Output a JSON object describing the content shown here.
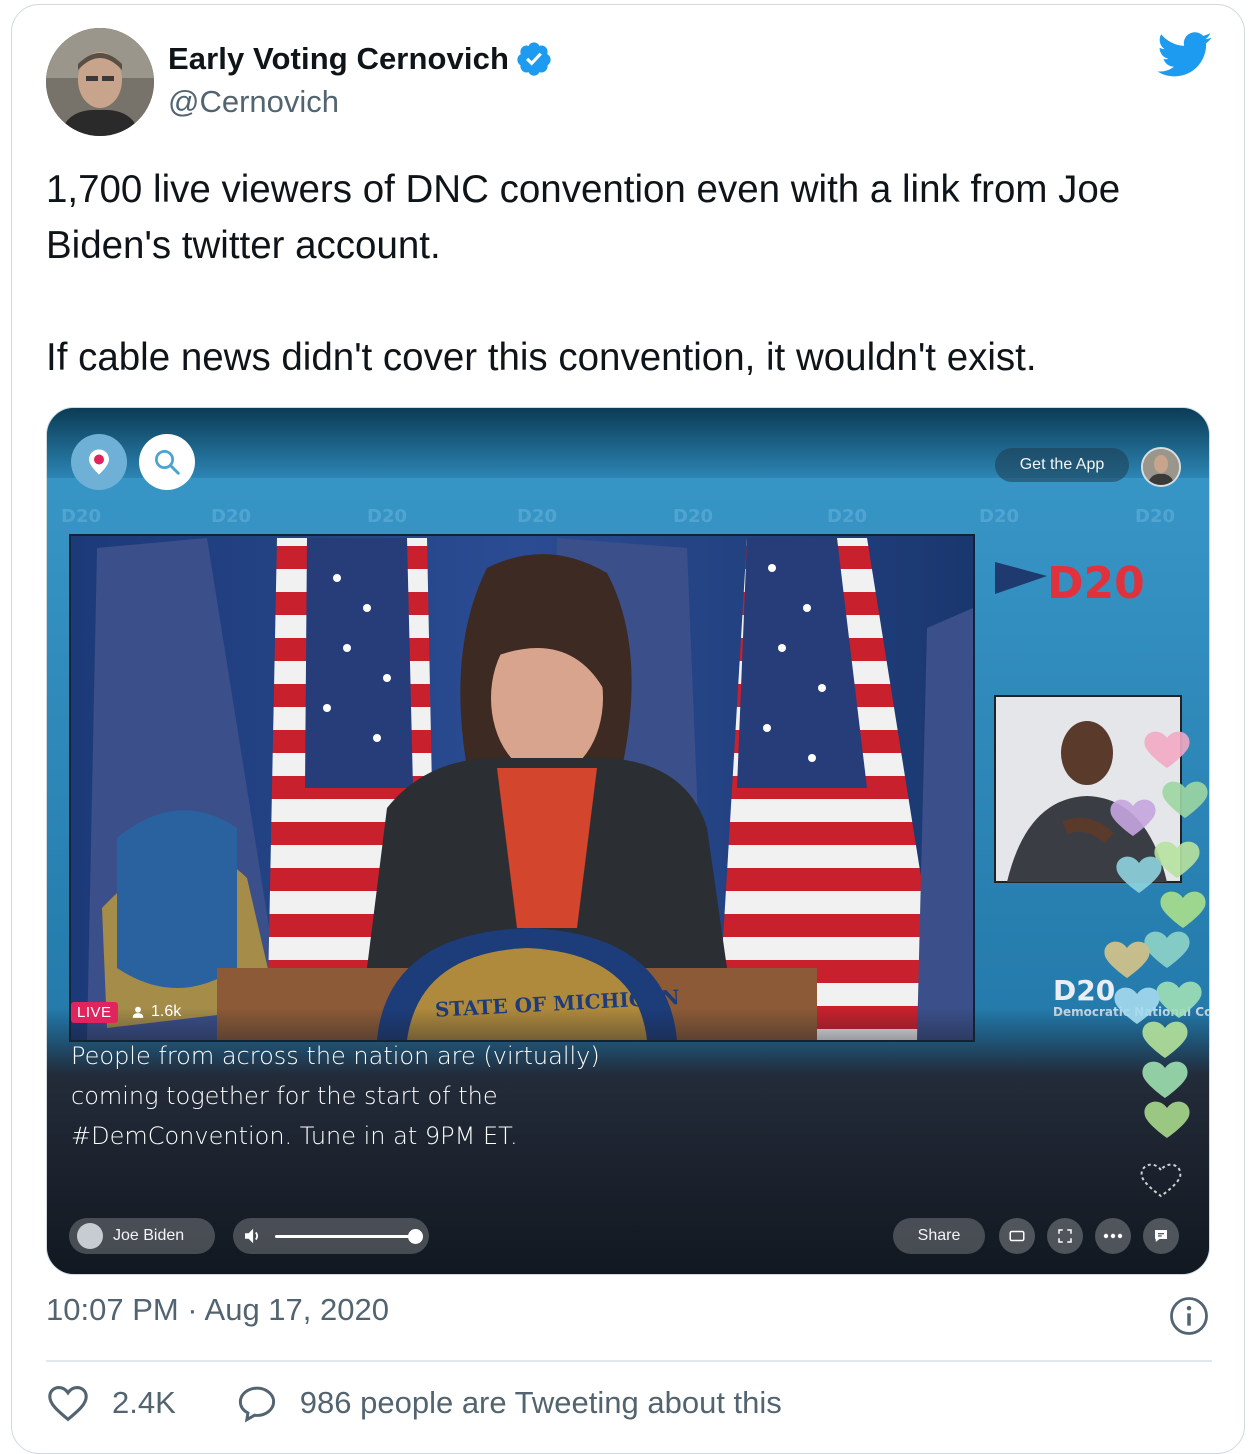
{
  "author": {
    "name": "Early Voting Cernovich",
    "handle": "@Cernovich",
    "verified": true
  },
  "tweet": {
    "paragraphs": [
      "1,700 live viewers of DNC convention even with a link from Joe Biden's twitter account.",
      "If cable news didn't cover this convention, it wouldn't exist."
    ],
    "timestamp": "10:07 PM · Aug 17, 2020"
  },
  "media": {
    "get_app_label": "Get the App",
    "live_label": "LIVE",
    "viewer_count": "1.6k",
    "caption": "People from across the nation are (virtually) coming together for the start of the #DemConvention. Tune in at 9PM ET.",
    "broadcaster": "Joe Biden",
    "volume_level": 1.0,
    "share_label": "Share",
    "podium_text": "STATE OF MICHIGAN",
    "logo_text": "D20",
    "logo_caption": "Democratic National Convention"
  },
  "engagement": {
    "likes": "2.4K",
    "conversation": "986 people are Tweeting about this"
  },
  "colors": {
    "brand_blue": "#1d9bf0",
    "live_red": "#e0245e",
    "secondary_text": "#536471"
  },
  "icons": [
    "twitter-bird-icon",
    "verified-badge-icon",
    "periscope-icon",
    "search-icon",
    "user-icon",
    "volume-icon",
    "theater-mode-icon",
    "fullscreen-icon",
    "more-icon",
    "chat-icon",
    "heart-icon",
    "reply-bubble-icon",
    "info-icon"
  ]
}
